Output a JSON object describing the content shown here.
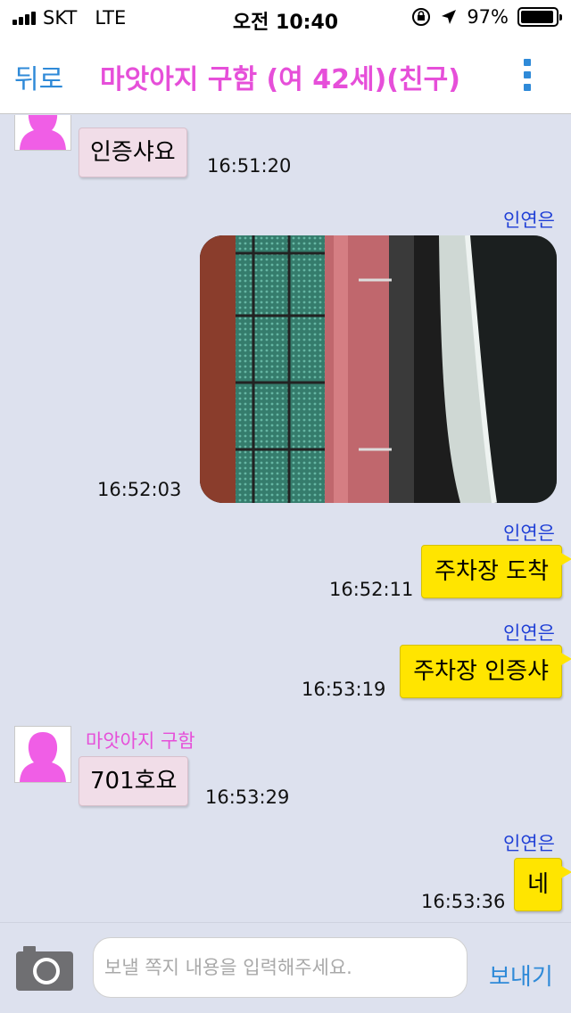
{
  "status_bar": {
    "carrier": "SKT",
    "network": "LTE",
    "time": "오전 10:40",
    "battery": "97%",
    "battery_level": 0.97
  },
  "nav": {
    "back_label": "뒤로",
    "title": "마앗아지 구함 (여 42세)(친구)",
    "menu_icon": "more-vertical-icon"
  },
  "messages": [
    {
      "side": "left",
      "text": "인증샤요",
      "time": "16:51:20"
    },
    {
      "side": "right",
      "sender": "인연은",
      "type": "image",
      "time": "16:52:03"
    },
    {
      "side": "right",
      "sender": "인연은",
      "text": "주차장 도착",
      "time": "16:52:11"
    },
    {
      "side": "right",
      "sender": "인연은",
      "text": "주차장 인증샤",
      "time": "16:53:19"
    },
    {
      "side": "left",
      "sender": "마앗아지 구함",
      "text": "701호요",
      "time": "16:53:29"
    },
    {
      "side": "right",
      "sender": "인연은",
      "text": "네",
      "time": "16:53:36"
    }
  ],
  "composer": {
    "placeholder": "보낼 쪽지 내용을 입력해주세요.",
    "value": "",
    "send_label": "보내기",
    "camera_icon": "camera-icon"
  },
  "colors": {
    "accent": "#2f8ad8",
    "title": "#e64fd9",
    "my_bubble": "#ffe500",
    "their_bubble": "#f1dde8",
    "background": "#dde1ee"
  }
}
